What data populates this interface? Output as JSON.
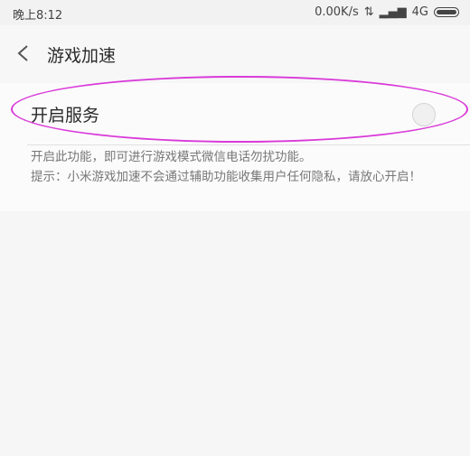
{
  "status_bar": {
    "time": "晚上8:12",
    "network_speed": "0.00K/s",
    "signal_text": "4G"
  },
  "header": {
    "back_icon": "chevron-left-icon",
    "title": "游戏加速"
  },
  "service_row": {
    "label": "开启服务",
    "toggle_state": false
  },
  "description": {
    "line1": "开启此功能，即可进行游戏模式微信电话勿扰功能。",
    "line2": "提示：小米游戏加速不会通过辅助功能收集用户任何隐私，请放心开启！"
  },
  "colors": {
    "annotation": "#d93ad9",
    "background": "#f6f6f6"
  }
}
